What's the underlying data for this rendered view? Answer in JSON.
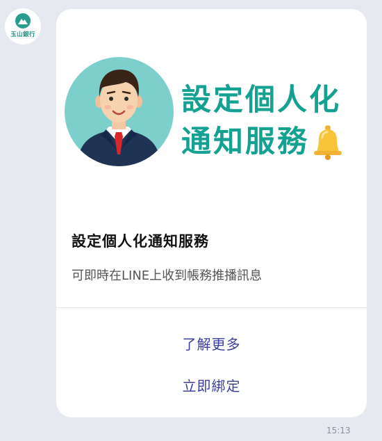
{
  "sender": {
    "name": "玉山銀行",
    "avatar_icon": "esun-bank-logo-icon"
  },
  "message": {
    "hero": {
      "line1": "設定個人化",
      "line2": "通知服務",
      "icon": "bell-icon",
      "illustration": "businessman-avatar-illustration",
      "accent_color": "#14a191",
      "circle_color": "#7ccfca"
    },
    "title": "設定個人化通知服務",
    "description": "可即時在LINE上收到帳務推播訊息",
    "actions": [
      {
        "label": "了解更多"
      },
      {
        "label": "立即綁定"
      }
    ],
    "action_color": "#3b3f99",
    "time": "15:13"
  }
}
